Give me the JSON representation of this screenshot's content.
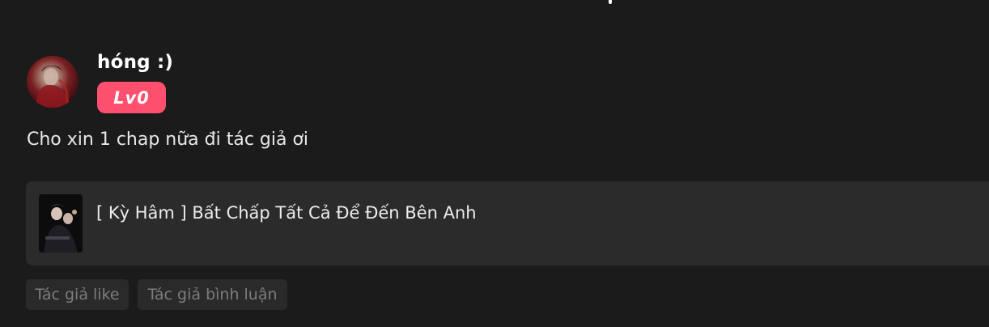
{
  "comment": {
    "username": "hóng :)",
    "level": "Lv0",
    "text": "Cho xin 1 chap nữa đi tác giả ơi"
  },
  "story_card": {
    "title": "[ Kỳ Hâm ] Bất Chấp Tất Cả Để Đến Bên Anh"
  },
  "author_actions": {
    "like_label": "Tác giả like",
    "comment_label": "Tác giả bình luận"
  },
  "colors": {
    "background": "#1b1b1b",
    "card": "#2b2b2b",
    "level_badge": "#ff4f6f",
    "chip_text": "#7d7d7d"
  }
}
